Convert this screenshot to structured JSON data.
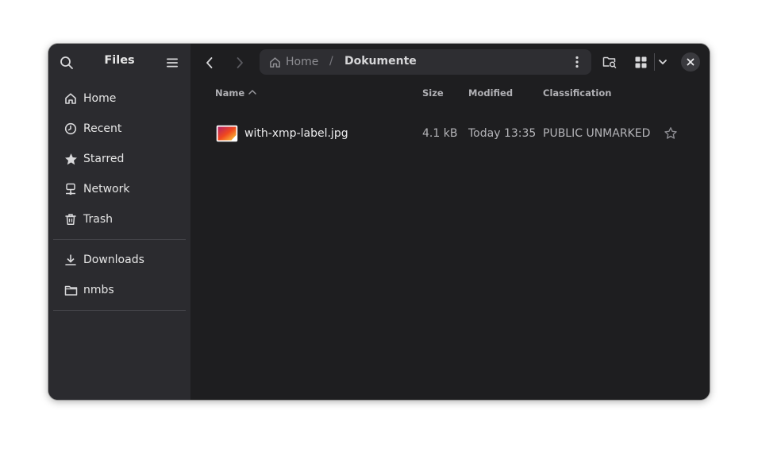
{
  "sidebar": {
    "title": "Files",
    "items": [
      {
        "label": "Home",
        "icon": "home-icon"
      },
      {
        "label": "Recent",
        "icon": "clock-icon"
      },
      {
        "label": "Starred",
        "icon": "star-icon"
      },
      {
        "label": "Network",
        "icon": "network-icon"
      },
      {
        "label": "Trash",
        "icon": "trash-icon"
      }
    ],
    "bookmarks": [
      {
        "label": "Downloads",
        "icon": "download-icon"
      },
      {
        "label": "nmbs",
        "icon": "folder-icon"
      }
    ]
  },
  "pathbar": {
    "home": "Home",
    "separator": "/",
    "current": "Dokumente"
  },
  "columns": {
    "name": "Name",
    "size": "Size",
    "modified": "Modified",
    "classification": "Classification"
  },
  "files": [
    {
      "name": "with-xmp-label.jpg",
      "size": "4.1 kB",
      "modified": "Today 13:35",
      "classification": "PUBLIC UNMARKED",
      "starred": false
    }
  ],
  "colors": {
    "sidebar_bg": "#2b2b2f",
    "main_bg": "#1e1e20",
    "text": "#e6e6e6",
    "muted_text": "#b4b4b8"
  }
}
